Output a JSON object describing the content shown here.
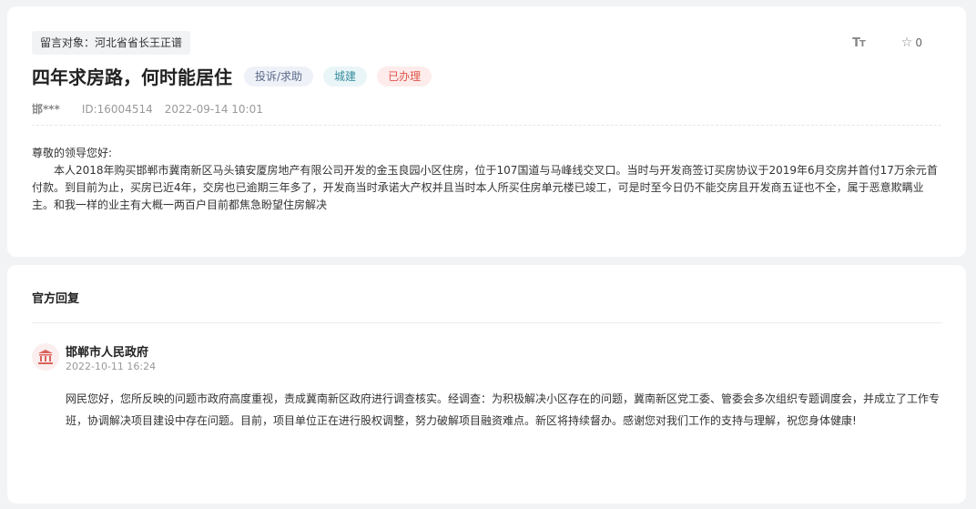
{
  "message": {
    "target_tag": "留言对象：河北省省长王正谱",
    "title": "四年求房路，何时能居住",
    "tags": {
      "type": "投诉/求助",
      "category": "城建",
      "status": "已办理"
    },
    "font_size_icon": "font-size-icon",
    "favorite_count": "0",
    "author": "邯***",
    "id_text": "ID:16004514",
    "datetime": "2022-09-14 10:01",
    "greeting": "尊敬的领导您好:",
    "body": "本人2018年购买邯郸市冀南新区马头镇安厦房地产有限公司开发的金玉良园小区住房，位于107国道与马峰线交叉口。当时与开发商签订买房协议于2019年6月交房并首付17万余元首付款。到目前为止，买房已近4年，交房也已逾期三年多了，开发商当时承诺大产权并且当时本人所买住房单元楼已竣工，可是时至今日仍不能交房且开发商五证也不全，属于恶意欺瞒业主。和我一样的业主有大概一两百户目前都焦急盼望住房解决"
  },
  "reply": {
    "section_title": "官方回复",
    "org_name": "邯郸市人民政府",
    "org_time": "2022-10-11 16:24",
    "body": "网民您好，您所反映的问题市政府高度重视，责成冀南新区政府进行调查核实。经调查：为积极解决小区存在的问题，冀南新区党工委、管委会多次组织专题调度会，并成立了工作专班，协调解决项目建设中存在问题。目前，项目单位正在进行股权调整，努力破解项目融资难点。新区将持续督办。感谢您对我们工作的支持与理解，祝您身体健康!"
  },
  "colors": {
    "status_red": "#e0534a",
    "category_teal": "#3a8ea0",
    "type_blue": "#5b6a8a",
    "gov_icon_red": "#d9625b"
  }
}
